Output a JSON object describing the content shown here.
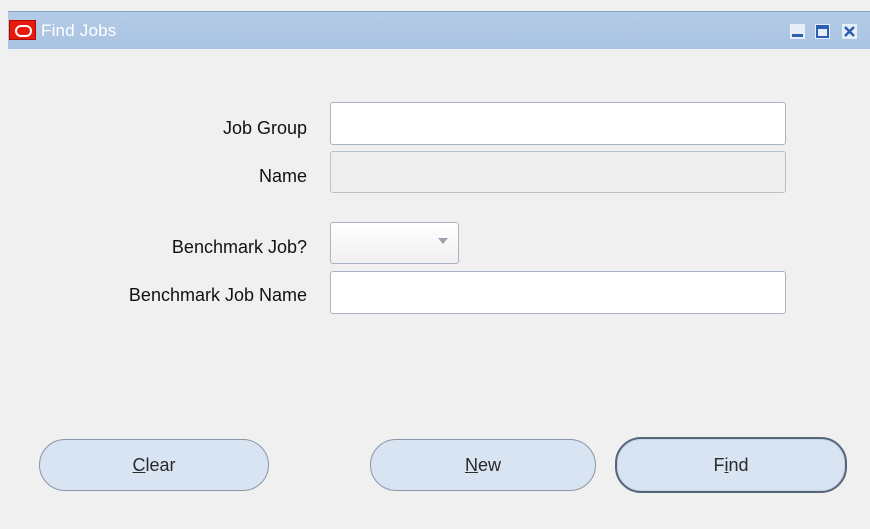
{
  "window": {
    "title": "Find Jobs",
    "controls": [
      "minimize-icon",
      "maximize-icon",
      "close-icon"
    ]
  },
  "form": {
    "job_group": {
      "label": "Job Group",
      "value": ""
    },
    "name": {
      "label": "Name",
      "value": ""
    },
    "benchmark_job": {
      "label": "Benchmark Job?",
      "value": ""
    },
    "benchmark_job_name": {
      "label": "Benchmark Job Name",
      "value": ""
    }
  },
  "buttons": {
    "clear": {
      "mnemonic": "C",
      "rest": "lear"
    },
    "new": {
      "mnemonic": "N",
      "rest": "ew"
    },
    "find": {
      "before": "F",
      "mnemonic": "i",
      "rest": "nd"
    }
  },
  "colors": {
    "titlebar": "#aec7e4",
    "logo": "#e8190d",
    "button_fill": "#d9e4f2"
  }
}
